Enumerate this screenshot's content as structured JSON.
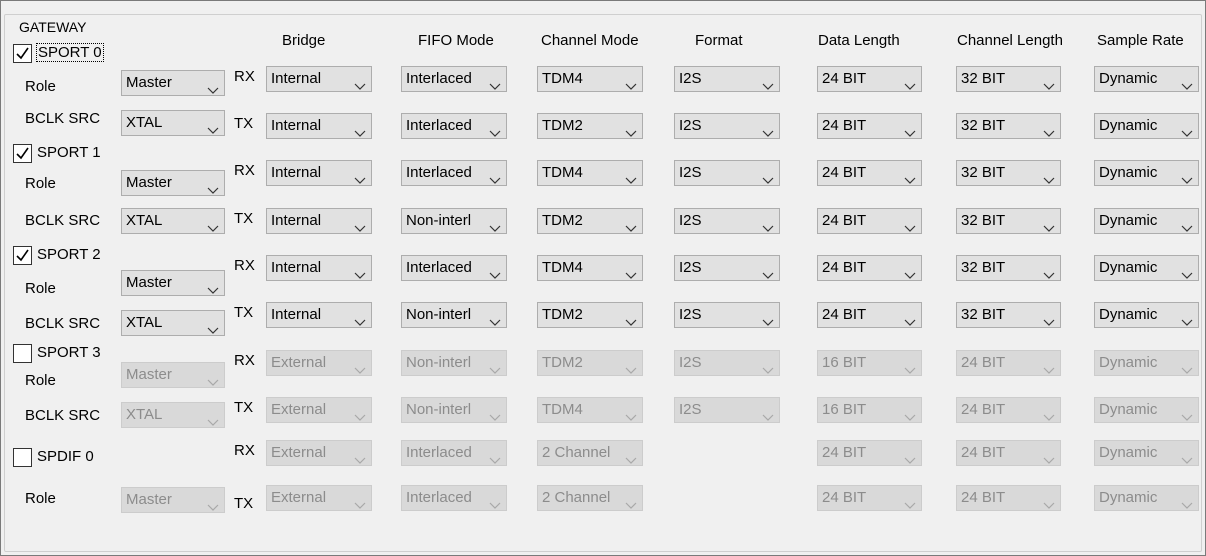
{
  "group_title": "GATEWAY",
  "headers": [
    "Bridge",
    "FIFO Mode",
    "Channel Mode",
    "Format",
    "Data Length",
    "Channel Length",
    "Sample Rate"
  ],
  "role_label": "Role",
  "bclk_label": "BCLK SRC",
  "ports": [
    {
      "name": "SPORT 0",
      "checked": true,
      "enabled": true,
      "focused": true,
      "role": "Master",
      "bclk": "XTAL",
      "rows": [
        {
          "dir": "RX",
          "bridge": "Internal",
          "fifo": "Interlaced",
          "channel": "TDM4",
          "format": "I2S",
          "data_len": "24 BIT",
          "chan_len": "32 BIT",
          "rate": "Dynamic"
        },
        {
          "dir": "TX",
          "bridge": "Internal",
          "fifo": "Interlaced",
          "channel": "TDM2",
          "format": "I2S",
          "data_len": "24 BIT",
          "chan_len": "32 BIT",
          "rate": "Dynamic"
        }
      ]
    },
    {
      "name": "SPORT 1",
      "checked": true,
      "enabled": true,
      "role": "Master",
      "bclk": "XTAL",
      "rows": [
        {
          "dir": "RX",
          "bridge": "Internal",
          "fifo": "Interlaced",
          "channel": "TDM4",
          "format": "I2S",
          "data_len": "24 BIT",
          "chan_len": "32 BIT",
          "rate": "Dynamic"
        },
        {
          "dir": "TX",
          "bridge": "Internal",
          "fifo": "Non-interl",
          "channel": "TDM2",
          "format": "I2S",
          "data_len": "24 BIT",
          "chan_len": "32 BIT",
          "rate": "Dynamic"
        }
      ]
    },
    {
      "name": "SPORT 2",
      "checked": true,
      "enabled": true,
      "role": "Master",
      "bclk": "XTAL",
      "rows": [
        {
          "dir": "RX",
          "bridge": "Internal",
          "fifo": "Interlaced",
          "channel": "TDM4",
          "format": "I2S",
          "data_len": "24 BIT",
          "chan_len": "32 BIT",
          "rate": "Dynamic"
        },
        {
          "dir": "TX",
          "bridge": "Internal",
          "fifo": "Non-interl",
          "channel": "TDM2",
          "format": "I2S",
          "data_len": "24 BIT",
          "chan_len": "32 BIT",
          "rate": "Dynamic"
        }
      ]
    },
    {
      "name": "SPORT 3",
      "checked": false,
      "enabled": false,
      "role": "Master",
      "bclk": "XTAL",
      "rows": [
        {
          "dir": "RX",
          "bridge": "External",
          "fifo": "Non-interl",
          "channel": "TDM2",
          "format": "I2S",
          "data_len": "16 BIT",
          "chan_len": "24 BIT",
          "rate": "Dynamic"
        },
        {
          "dir": "TX",
          "bridge": "External",
          "fifo": "Non-interl",
          "channel": "TDM4",
          "format": "I2S",
          "data_len": "16 BIT",
          "chan_len": "24 BIT",
          "rate": "Dynamic"
        }
      ]
    },
    {
      "name": "SPDIF 0",
      "checked": false,
      "enabled": false,
      "role": "Master",
      "rows": [
        {
          "dir": "RX",
          "bridge": "External",
          "fifo": "Interlaced",
          "channel": "2 Channel",
          "data_len": "24 BIT",
          "chan_len": "24 BIT",
          "rate": "Dynamic"
        },
        {
          "dir": "TX",
          "bridge": "External",
          "fifo": "Interlaced",
          "channel": "2 Channel",
          "data_len": "24 BIT",
          "chan_len": "24 BIT",
          "rate": "Dynamic"
        }
      ]
    }
  ]
}
